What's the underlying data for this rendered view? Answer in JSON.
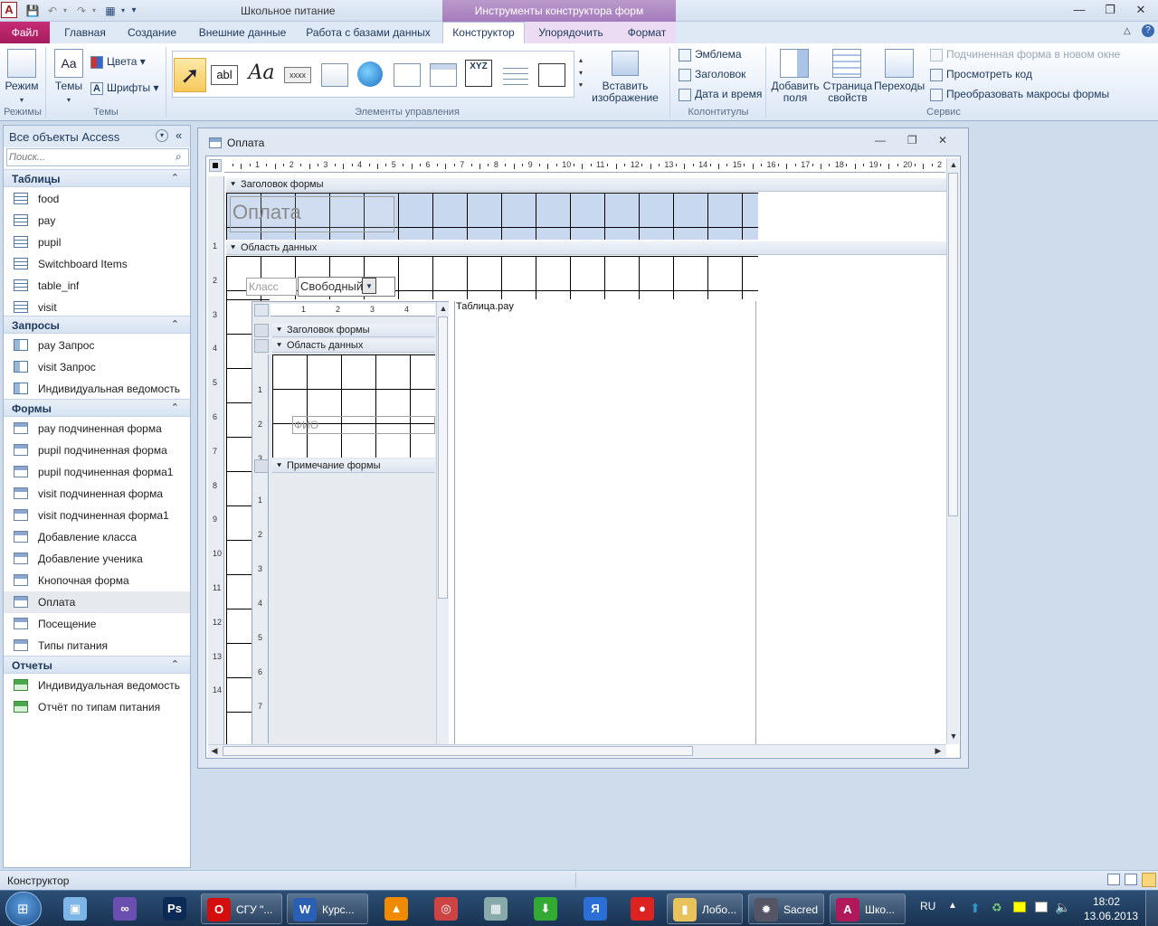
{
  "app": {
    "title": "Школьное питание",
    "context_title": "Инструменты конструктора форм",
    "icon_letter": "A"
  },
  "tabs": {
    "file": "Файл",
    "items": [
      "Главная",
      "Создание",
      "Внешние данные",
      "Работа с базами данных",
      "Конструктор",
      "Упорядочить",
      "Формат"
    ]
  },
  "ribbon": {
    "views": {
      "mode": "Режим",
      "group": "Режимы"
    },
    "themes": {
      "themes": "Темы",
      "colors": "Цвета",
      "fonts": "Шрифты",
      "group": "Темы"
    },
    "controls": {
      "group": "Элементы управления",
      "insert_image": "Вставить изображение",
      "label_glyph": "abl",
      "aa_glyph": "Aa",
      "xxxx_glyph": "xxxx",
      "xyz_glyph": "XYZ"
    },
    "header_footer": {
      "logo": "Эмблема",
      "title": "Заголовок",
      "datetime": "Дата и время",
      "group": "Колонтитулы"
    },
    "tools": {
      "add_fields": "Добавить поля",
      "property_sheet": "Страница свойств",
      "tab_order": "Переходы",
      "subform_new_window": "Подчиненная форма в новом окне",
      "view_code": "Просмотреть код",
      "convert_macros": "Преобразовать макросы формы",
      "group": "Сервис"
    }
  },
  "nav": {
    "title": "Все объекты Access",
    "search_placeholder": "Поиск...",
    "sections": [
      {
        "title": "Таблицы",
        "kind": "table",
        "items": [
          "food",
          "pay",
          "pupil",
          "Switchboard Items",
          "table_inf",
          "visit"
        ]
      },
      {
        "title": "Запросы",
        "kind": "query",
        "items": [
          "pay Запрос",
          "visit Запрос",
          "Индивидуальная ведомость"
        ]
      },
      {
        "title": "Формы",
        "kind": "form",
        "items": [
          "pay подчиненная форма",
          "pupil подчиненная форма",
          "pupil подчиненная форма1",
          "visit подчиненная форма",
          "visit подчиненная форма1",
          "Добавление класса",
          "Добавление ученика",
          "Кнопочная форма",
          "Оплата",
          "Посещение",
          "Типы питания"
        ]
      },
      {
        "title": "Отчеты",
        "kind": "report",
        "items": [
          "Индивидуальная ведомость",
          "Отчёт по типам питания"
        ]
      }
    ],
    "selected": "Оплата"
  },
  "form": {
    "window_title": "Оплата",
    "header_section": "Заголовок формы",
    "detail_section": "Область данных",
    "title_label": "Оплата",
    "class_label": "Класс",
    "class_combo": "Свободный",
    "subform_source": "Таблица.pay",
    "subform": {
      "header_section": "Заголовок формы",
      "detail_section": "Область данных",
      "footer_section": "Примечание формы",
      "fio_label": "ФИО"
    },
    "ruler_top": [
      "1",
      "2",
      "3",
      "4",
      "5",
      "6",
      "7",
      "8",
      "9",
      "10",
      "11",
      "12",
      "13",
      "14",
      "15",
      "16",
      "17",
      "18",
      "19",
      "20",
      "2"
    ],
    "ruler_left": [
      "1",
      "2",
      "3",
      "4",
      "5",
      "6",
      "7",
      "8",
      "9",
      "10",
      "11",
      "12",
      "13",
      "14"
    ],
    "sub_ruler_top": [
      "1",
      "2",
      "3",
      "4"
    ],
    "sub_ruler_left": [
      "1",
      "2",
      "3",
      "1",
      "2",
      "3",
      "4",
      "5",
      "6",
      "7"
    ]
  },
  "status": {
    "text": "Конструктор"
  },
  "taskbar": {
    "items": [
      {
        "label": "",
        "icon": "3d-box"
      },
      {
        "label": "",
        "icon": "vs"
      },
      {
        "label": "",
        "icon": "Ps"
      },
      {
        "label": "СГУ \"...",
        "icon": "O"
      },
      {
        "label": "Курс...",
        "icon": "W"
      },
      {
        "label": "",
        "icon": "vlc"
      },
      {
        "label": "",
        "icon": "game"
      },
      {
        "label": "",
        "icon": "calc"
      },
      {
        "label": "",
        "icon": "download"
      },
      {
        "label": "",
        "icon": "yandex"
      },
      {
        "label": "",
        "icon": "record"
      },
      {
        "label": "Лобо...",
        "icon": "folder"
      },
      {
        "label": "Sacred",
        "icon": "sacred"
      },
      {
        "label": "Шко...",
        "icon": "access"
      }
    ],
    "lang": "RU",
    "time": "18:02",
    "date": "13.06.2013"
  }
}
